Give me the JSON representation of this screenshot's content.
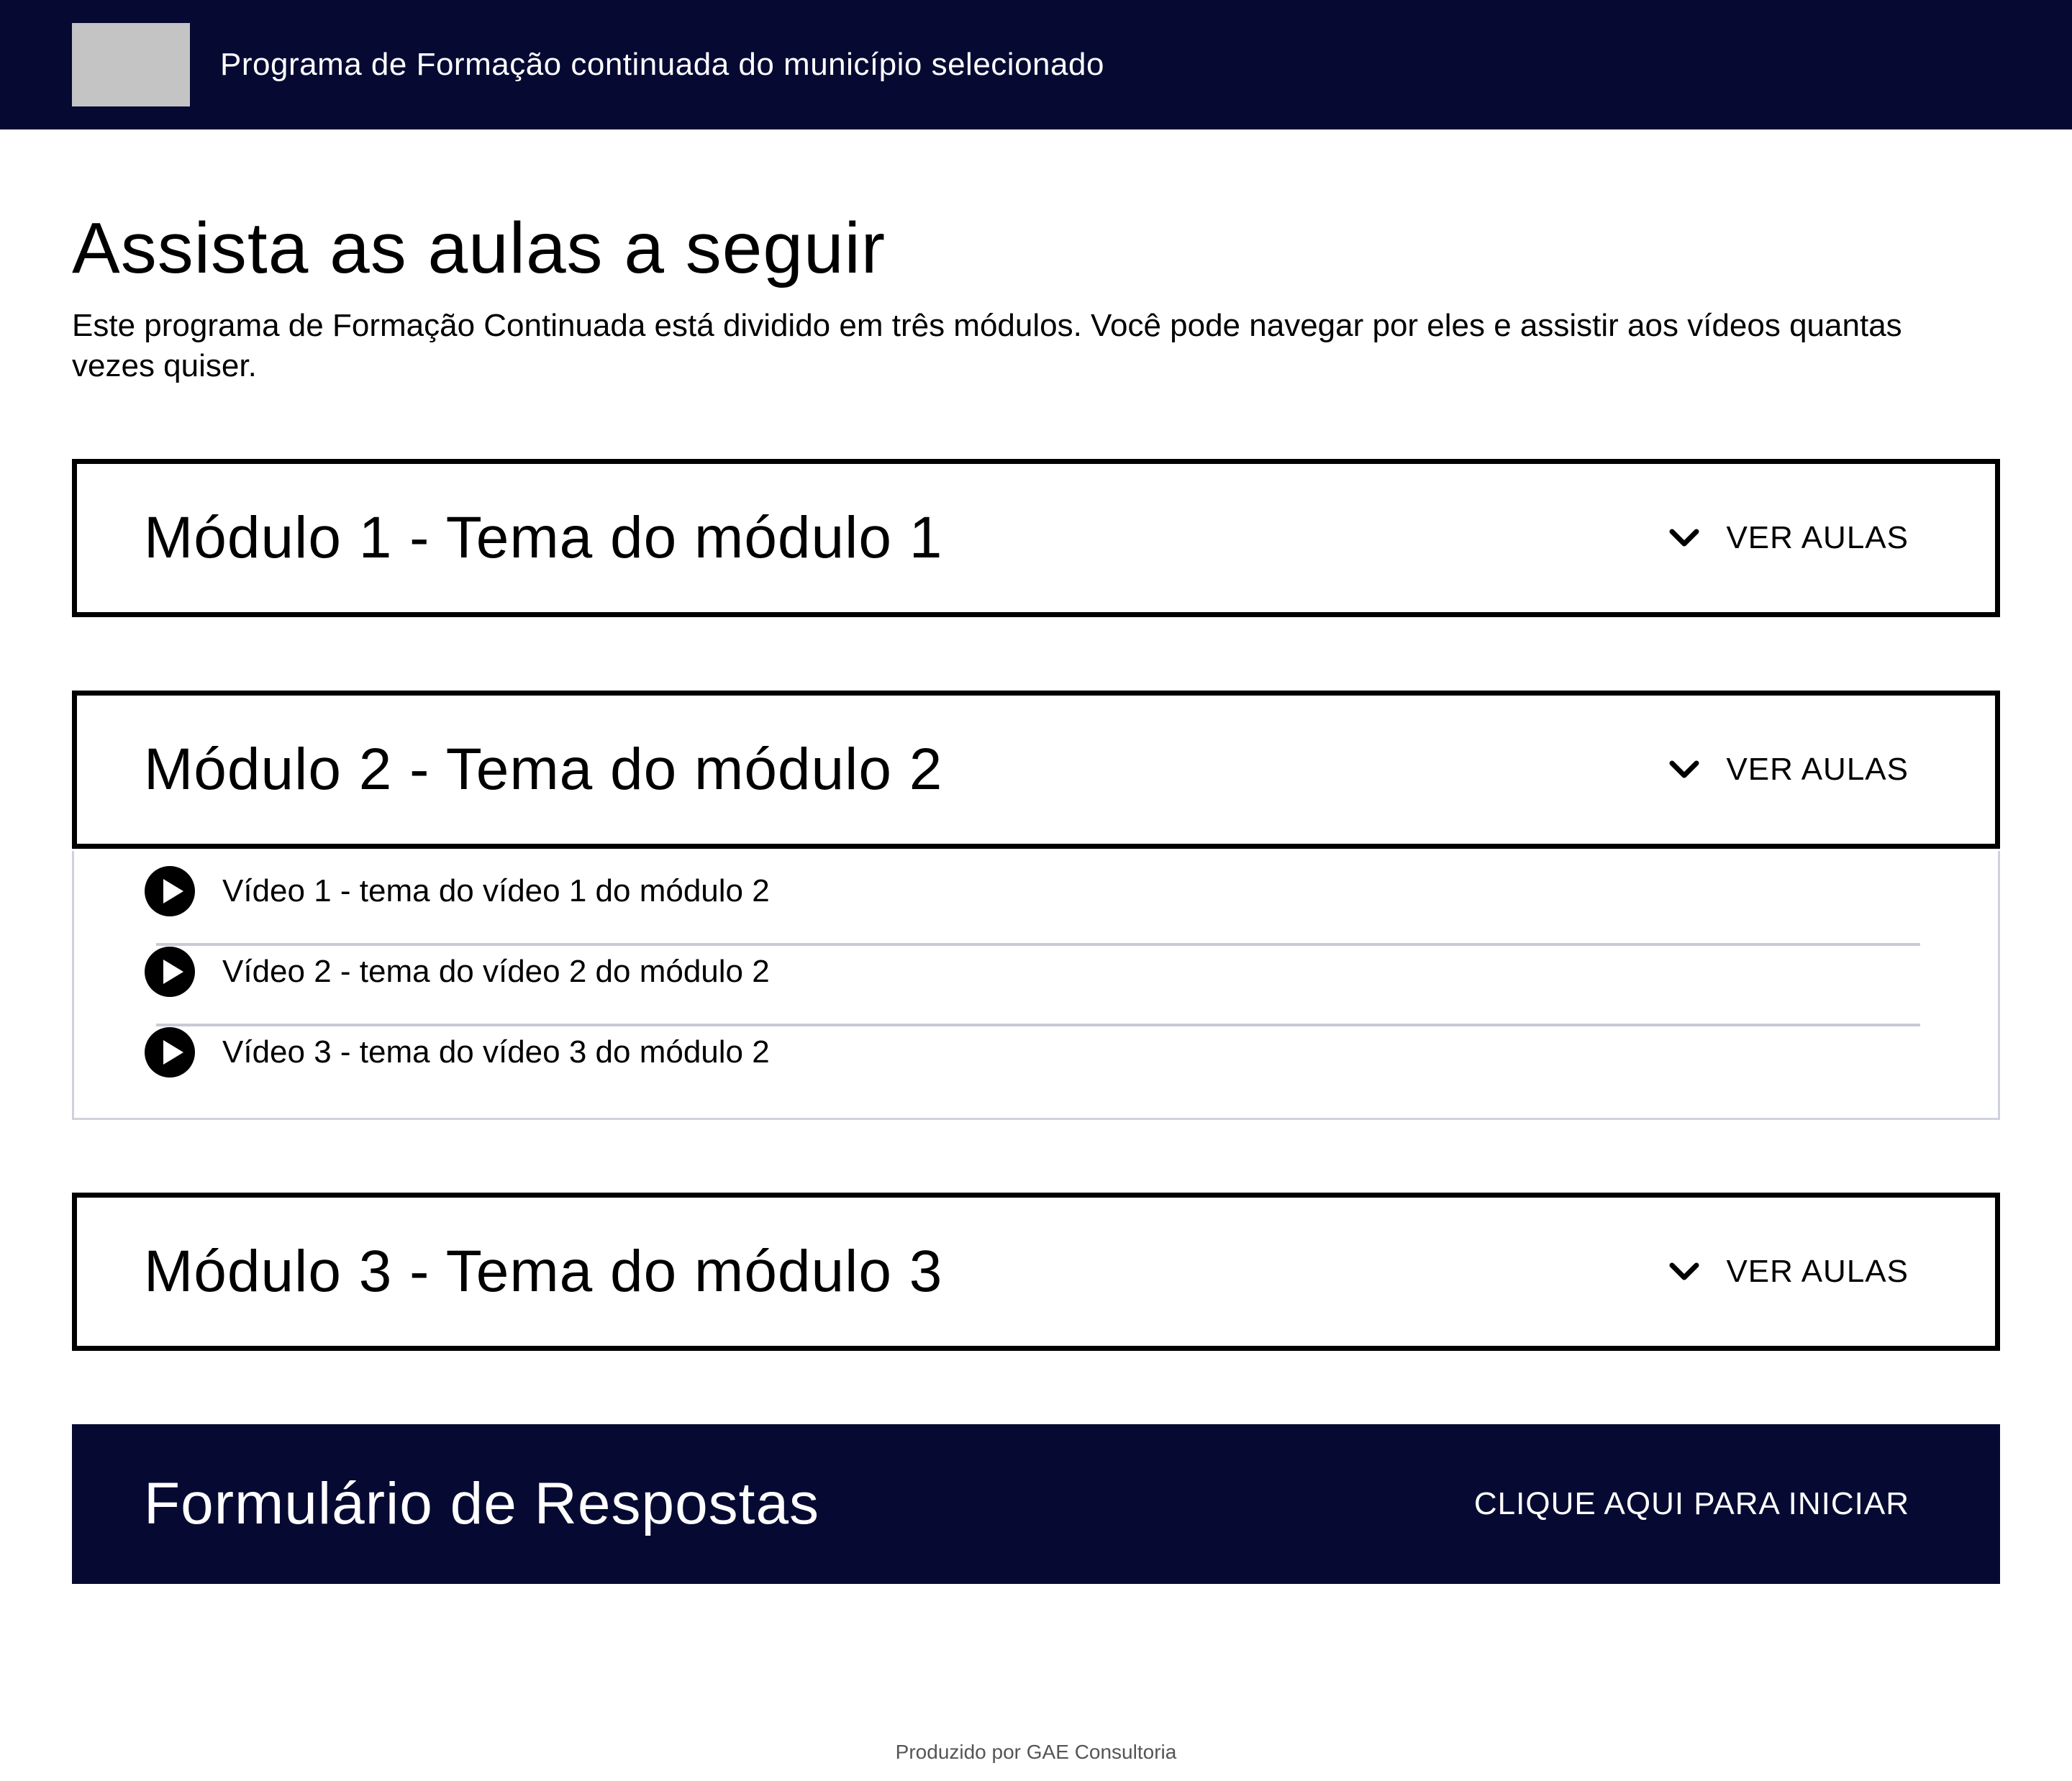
{
  "header": {
    "title": "Programa de Formação continuada do município selecionado",
    "logo_icon": "logo-placeholder"
  },
  "main": {
    "title": "Assista as aulas a seguir",
    "intro": "Este programa de Formação Continuada está dividido em três módulos. Você pode navegar por eles e assistir aos vídeos quantas vezes quiser."
  },
  "modules": [
    {
      "title": "Módulo 1 - Tema do módulo 1",
      "toggle_label": "VER AULAS",
      "expanded": false
    },
    {
      "title": "Módulo 2 - Tema do módulo 2",
      "toggle_label": "VER AULAS",
      "expanded": true,
      "videos": [
        {
          "label": "Vídeo 1 - tema do vídeo 1 do módulo 2"
        },
        {
          "label": "Vídeo 2 - tema do vídeo 2 do módulo 2"
        },
        {
          "label": "Vídeo 3 - tema do vídeo 3 do módulo 2"
        }
      ]
    },
    {
      "title": "Módulo 3 - Tema do módulo 3",
      "toggle_label": "VER AULAS",
      "expanded": false
    }
  ],
  "form": {
    "title": "Formulário de Respostas",
    "cta": "CLIQUE AQUI PARA INICIAR"
  },
  "footer": {
    "text": "Produzido por GAE Consultoria"
  },
  "colors": {
    "brand_dark": "#060a33",
    "border": "#000000",
    "divider": "#c8cad4"
  }
}
